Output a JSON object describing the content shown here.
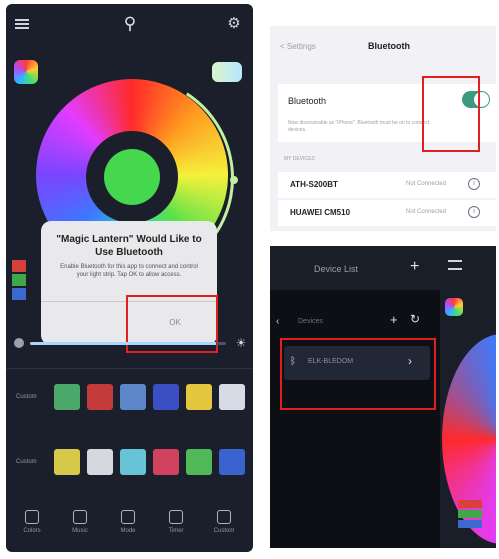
{
  "left_phone": {
    "dialog": {
      "title": "\"Magic Lantern\" Would Like to Use Bluetooth",
      "message": "Enable Bluetooth for this app to connect and control your light strip. Tap OK to allow access.",
      "ok_label": "OK"
    },
    "swatch_rows": [
      {
        "label": "Custom",
        "colors": [
          "#4aa86a",
          "#c53a3a",
          "#5b86c9",
          "#3b4fc4",
          "#e4c73f",
          "#d7dbe6"
        ]
      },
      {
        "label": "Custom",
        "colors": [
          "#d8c84a",
          "#d7d7df",
          "#67c3d6",
          "#d0425f",
          "#4fb857",
          "#3a63d0"
        ]
      }
    ],
    "mini_swatches": [
      "#d84040",
      "#3ea84a",
      "#3a6ad0"
    ],
    "tabs": [
      "Colors",
      "Music",
      "Mode",
      "Timer",
      "Custom"
    ],
    "brightness": 0.95
  },
  "bluetooth_settings": {
    "back_label": "< Settings",
    "title": "Bluetooth",
    "bluetooth_label": "Bluetooth",
    "bluetooth_on": true,
    "description": "Now discoverable as \"iPhone\". Bluetooth must be on to connect devices.",
    "section_header": "MY DEVICES",
    "devices": [
      {
        "name": "ATH-S200BT",
        "status": "Not Connected"
      },
      {
        "name": "HUAWEI CM510",
        "status": "Not Connected"
      }
    ]
  },
  "device_panel": {
    "title": "Device List",
    "subtitle": "Devices",
    "device_name": "ELK-BLEDOM",
    "mini_swatches": [
      "#d84040",
      "#3ea84a",
      "#3a6ad0"
    ]
  }
}
